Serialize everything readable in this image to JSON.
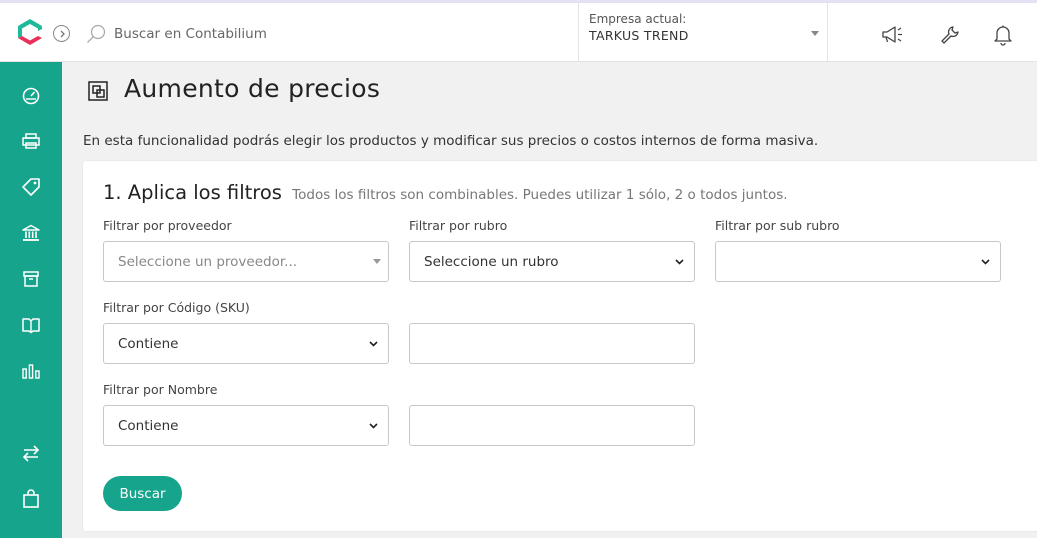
{
  "header": {
    "search_placeholder": "Buscar en Contabilium",
    "company_label": "Empresa actual:",
    "company_name": "TARKUS TREND",
    "icons": [
      "megaphone-icon",
      "wrench-icon",
      "bell-icon"
    ]
  },
  "sidebar": {
    "icons": [
      "dashboard-icon",
      "printer-icon",
      "tag-icon",
      "bank-icon",
      "box-icon",
      "book-icon",
      "bar-chart-icon",
      "transfer-icon",
      "shopping-bag-icon"
    ]
  },
  "page": {
    "title": "Aumento de precios",
    "description": "En esta funcionalidad podrás elegir los productos y modificar sus precios o costos internos de forma masiva."
  },
  "filters": {
    "title": "1. Aplica los filtros",
    "hint": "Todos los filtros son combinables. Puedes utilizar 1 sólo, 2 o todos juntos.",
    "proveedor_label": "Filtrar por proveedor",
    "proveedor_placeholder": "Seleccione un proveedor...",
    "rubro_label": "Filtrar por rubro",
    "rubro_value": "Seleccione un rubro",
    "subrubro_label": "Filtrar por sub rubro",
    "subrubro_value": "",
    "sku_label": "Filtrar por Código (SKU)",
    "sku_mode": "Contiene",
    "sku_value": "",
    "nombre_label": "Filtrar por Nombre",
    "nombre_mode": "Contiene",
    "nombre_value": "",
    "search_button": "Buscar"
  },
  "colors": {
    "brand": "#16a58c"
  }
}
